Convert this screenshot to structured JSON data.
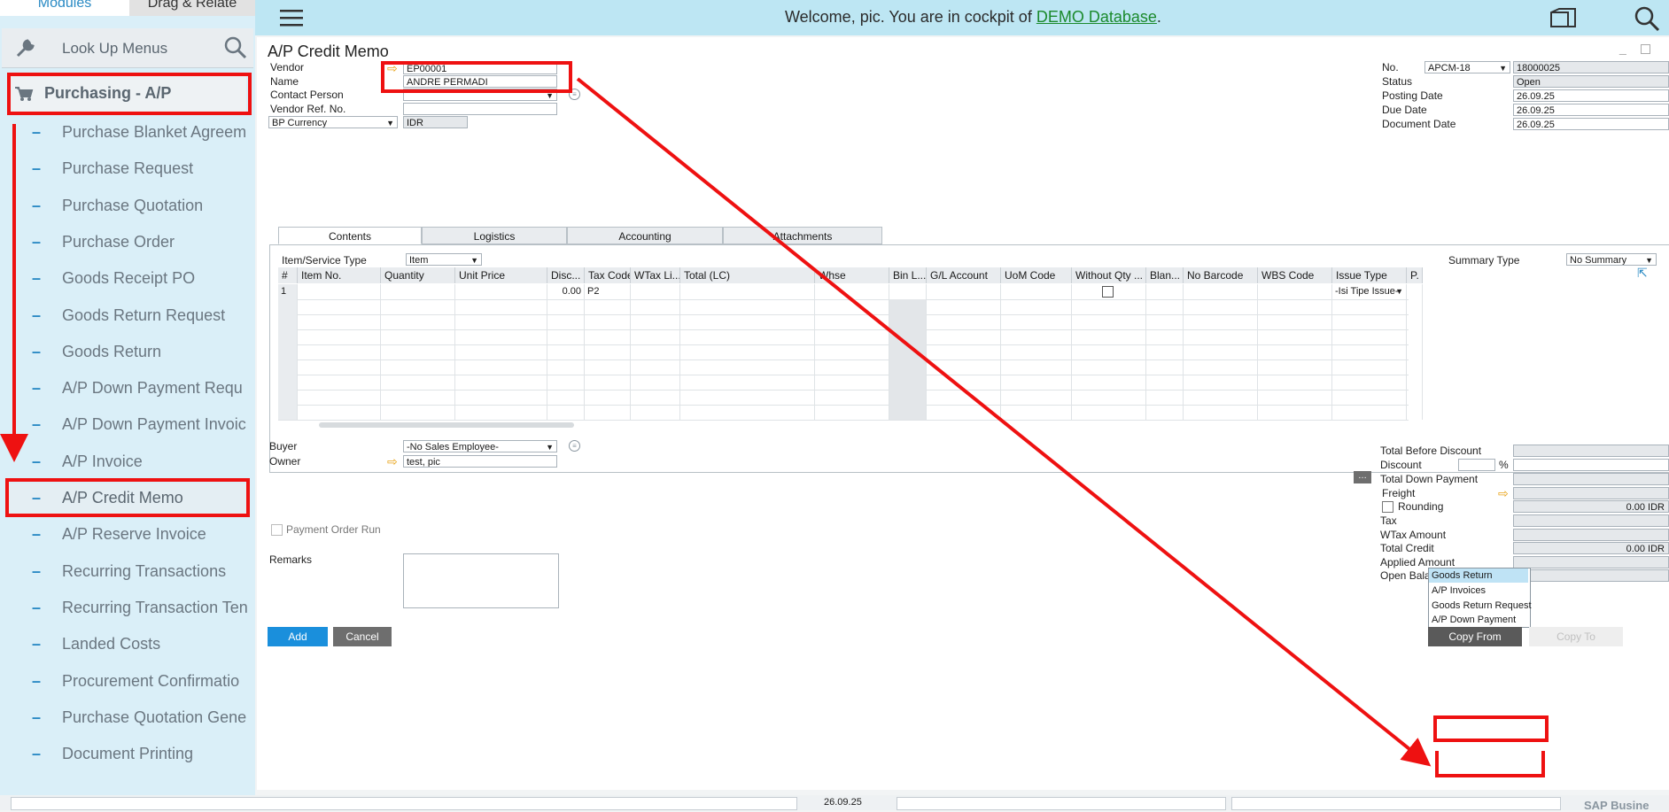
{
  "sidebar": {
    "tab_modules": "Modules",
    "tab_drag": "Drag & Relate",
    "lookup_label": "Look Up Menus",
    "module_title": "Purchasing - A/P",
    "items": [
      {
        "label": "Purchase Blanket Agreem"
      },
      {
        "label": "Purchase Request"
      },
      {
        "label": "Purchase Quotation"
      },
      {
        "label": "Purchase Order"
      },
      {
        "label": "Goods Receipt PO"
      },
      {
        "label": "Goods Return Request"
      },
      {
        "label": "Goods Return"
      },
      {
        "label": "A/P Down Payment Requ"
      },
      {
        "label": "A/P Down Payment Invoic"
      },
      {
        "label": "A/P Invoice"
      },
      {
        "label": "A/P Credit Memo"
      },
      {
        "label": "A/P Reserve Invoice"
      },
      {
        "label": "Recurring Transactions"
      },
      {
        "label": "Recurring Transaction Ten"
      },
      {
        "label": "Landed Costs"
      },
      {
        "label": "Procurement Confirmatio"
      },
      {
        "label": "Purchase Quotation Gene"
      },
      {
        "label": "Document Printing"
      }
    ],
    "selected_item": "A/P Credit Memo"
  },
  "topbar": {
    "welcome_prefix": "Welcome, pic. You are in cockpit of ",
    "database_link": "DEMO Database",
    "welcome_suffix": "."
  },
  "form": {
    "title": "A/P Credit Memo",
    "header_left": {
      "vendor_label": "Vendor",
      "vendor_value": "EP00001",
      "name_label": "Name",
      "name_value": "ANDRE PERMADI",
      "contact_label": "Contact Person",
      "contact_value": "",
      "vendor_ref_label": "Vendor Ref. No.",
      "vendor_ref_value": "",
      "currency_label": "BP Currency",
      "currency_value": "IDR"
    },
    "header_right": {
      "no_label": "No.",
      "series_value": "APCM-18",
      "no_value": "18000025",
      "status_label": "Status",
      "status_value": "Open",
      "posting_label": "Posting Date",
      "posting_value": "26.09.25",
      "due_label": "Due Date",
      "due_value": "26.09.25",
      "document_label": "Document Date",
      "document_value": "26.09.25"
    },
    "tabs": [
      "Contents",
      "Logistics",
      "Accounting",
      "Attachments"
    ],
    "item_type_label": "Item/Service Type",
    "item_type_value": "Item",
    "summary_label": "Summary Type",
    "summary_value": "No Summary",
    "grid": {
      "columns": [
        "#",
        "Item No.",
        "Quantity",
        "Unit Price",
        "Disc...",
        "Tax Code",
        "WTax Li...",
        "Total (LC)",
        "Whse",
        "Bin L...",
        "G/L Account",
        "UoM Code",
        "Without Qty ...",
        "Blan...",
        "No Barcode",
        "WBS Code",
        "Issue Type",
        "P."
      ],
      "row1": {
        "num": "1",
        "discount": "0.00",
        "tax_code": "P2",
        "issue_type": "-Isi Tipe Issue-"
      }
    },
    "buyer_label": "Buyer",
    "buyer_value": "-No Sales Employee-",
    "owner_label": "Owner",
    "owner_value": "test, pic",
    "payment_order_label": "Payment Order Run",
    "remarks_label": "Remarks",
    "totals": {
      "before_discount_label": "Total Before Discount",
      "discount_label": "Discount",
      "percent": "%",
      "down_payment_label": "Total Down Payment",
      "freight_label": "Freight",
      "rounding_label": "Rounding",
      "rounding_value": "0.00 IDR",
      "tax_label": "Tax",
      "wtax_label": "WTax Amount",
      "total_credit_label": "Total Credit",
      "total_credit_value": "0.00 IDR",
      "applied_label": "Applied Amount",
      "open_balance_label": "Open Balan"
    },
    "copy_from_menu": [
      "Goods Return",
      "A/P Invoices",
      "Goods Return Request",
      "A/P Down Payment"
    ],
    "buttons": {
      "add": "Add",
      "cancel": "Cancel",
      "copy_from": "Copy From",
      "copy_to": "Copy To"
    }
  },
  "statusbar": {
    "date": "26.09.25",
    "brand": "SAP Busine"
  },
  "colors": {
    "annotation": "#ee1111",
    "primary_button": "#1a8fdc",
    "grey_button": "#6e6e6e",
    "sidebar_bg": "#daeff8",
    "topbar_bg": "#bde6f3"
  }
}
